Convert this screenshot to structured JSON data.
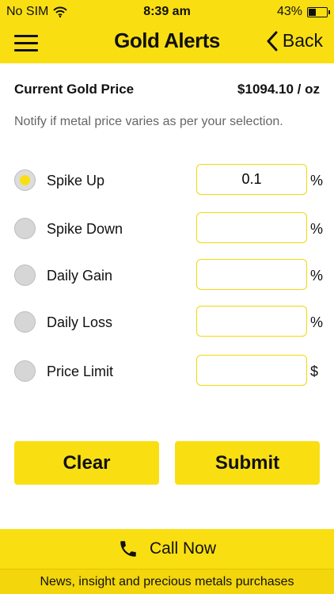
{
  "status_bar": {
    "carrier": "No SIM",
    "time": "8:39 am",
    "battery": "43%",
    "battery_level": 0.43
  },
  "header": {
    "title": "Gold Alerts",
    "back_label": "Back"
  },
  "price": {
    "label": "Current Gold Price",
    "value": "$1094.10 / oz"
  },
  "notify_text": "Notify if metal price varies as per your selection.",
  "options": [
    {
      "label": "Spike Up",
      "value": "0.1",
      "unit": "%",
      "selected": true
    },
    {
      "label": "Spike Down",
      "value": "",
      "unit": "%",
      "selected": false
    },
    {
      "label": "Daily Gain",
      "value": "",
      "unit": "%",
      "selected": false
    },
    {
      "label": "Daily Loss",
      "value": "",
      "unit": "%",
      "selected": false
    },
    {
      "label": "Price Limit",
      "value": "",
      "unit": "$",
      "selected": false
    }
  ],
  "buttons": {
    "clear": "Clear",
    "submit": "Submit"
  },
  "call": {
    "label": "Call Now"
  },
  "footer": {
    "text": "News, insight and precious metals purchases"
  },
  "colors": {
    "accent": "#f9df12",
    "radio_off": "#d6d6d6",
    "muted_text": "#666666"
  },
  "icons": {
    "menu": "hamburger-menu-icon",
    "back": "chevron-left-icon",
    "wifi": "wifi-icon",
    "battery": "battery-icon",
    "phone": "phone-icon"
  }
}
